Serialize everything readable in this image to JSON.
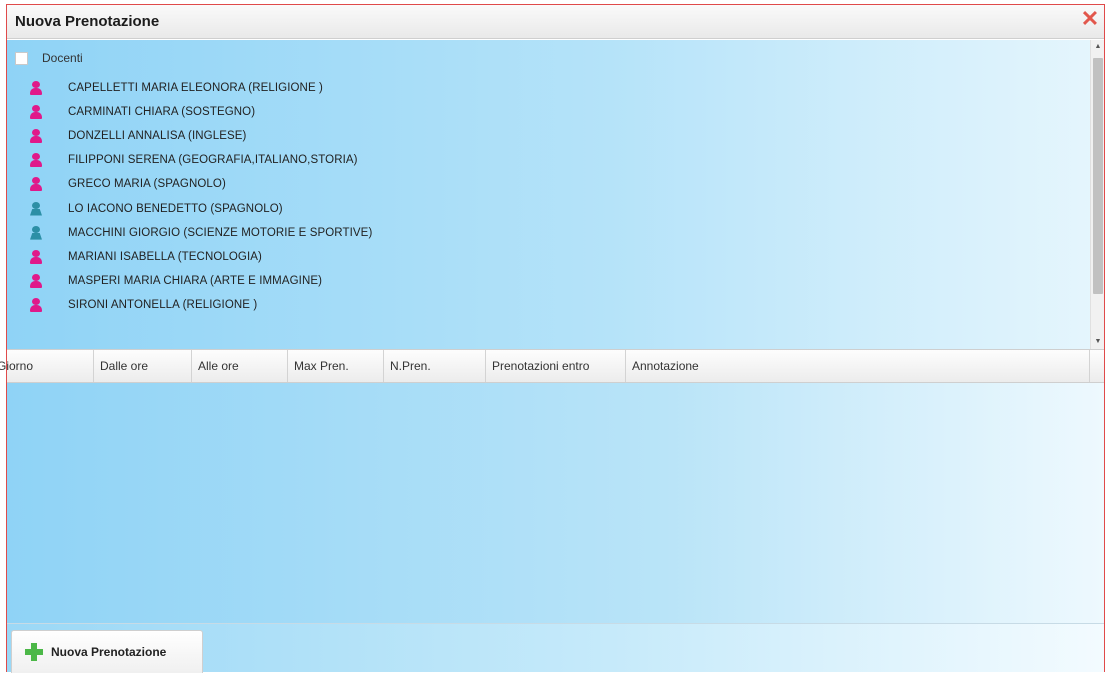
{
  "window": {
    "title": "Nuova Prenotazione",
    "close_glyph": "✕",
    "close_icon": "close-icon"
  },
  "tree": {
    "root_label": "Docenti",
    "items": [
      {
        "label": "CAPELLETTI MARIA ELEONORA (RELIGIONE )",
        "icon": "female-user-icon"
      },
      {
        "label": "CARMINATI CHIARA (SOSTEGNO)",
        "icon": "female-user-icon"
      },
      {
        "label": "DONZELLI ANNALISA (INGLESE)",
        "icon": "female-user-icon"
      },
      {
        "label": "FILIPPONI SERENA (GEOGRAFIA,ITALIANO,STORIA)",
        "icon": "female-user-icon"
      },
      {
        "label": "GRECO MARIA (SPAGNOLO)",
        "icon": "female-user-icon"
      },
      {
        "label": "LO IACONO BENEDETTO (SPAGNOLO)",
        "icon": "male-user-icon"
      },
      {
        "label": "MACCHINI GIORGIO (SCIENZE MOTORIE E SPORTIVE)",
        "icon": "male-user-icon"
      },
      {
        "label": "MARIANI ISABELLA (TECNOLOGIA)",
        "icon": "female-user-icon"
      },
      {
        "label": "MASPERI MARIA CHIARA (ARTE E IMMAGINE)",
        "icon": "female-user-icon"
      },
      {
        "label": "SIRONI ANTONELLA (RELIGIONE )",
        "icon": "female-user-icon"
      }
    ],
    "scroll_up_glyph": "▲",
    "scroll_down_glyph": "▼"
  },
  "grid": {
    "columns": [
      "Giorno",
      "Dalle ore",
      "Alle ore",
      "Max Pren.",
      "N.Pren.",
      "Prenotazioni entro",
      "Annotazione"
    ]
  },
  "footer": {
    "new_button_label": "Nuova Prenotazione",
    "new_button_icon": "plus-icon"
  },
  "colors": {
    "window_border": "#e04a4a",
    "female_icon": "#e0198a",
    "male_icon": "#2c8fa6",
    "plus_icon": "#4cb848",
    "background_gradient_start": "#8fd3f6"
  }
}
